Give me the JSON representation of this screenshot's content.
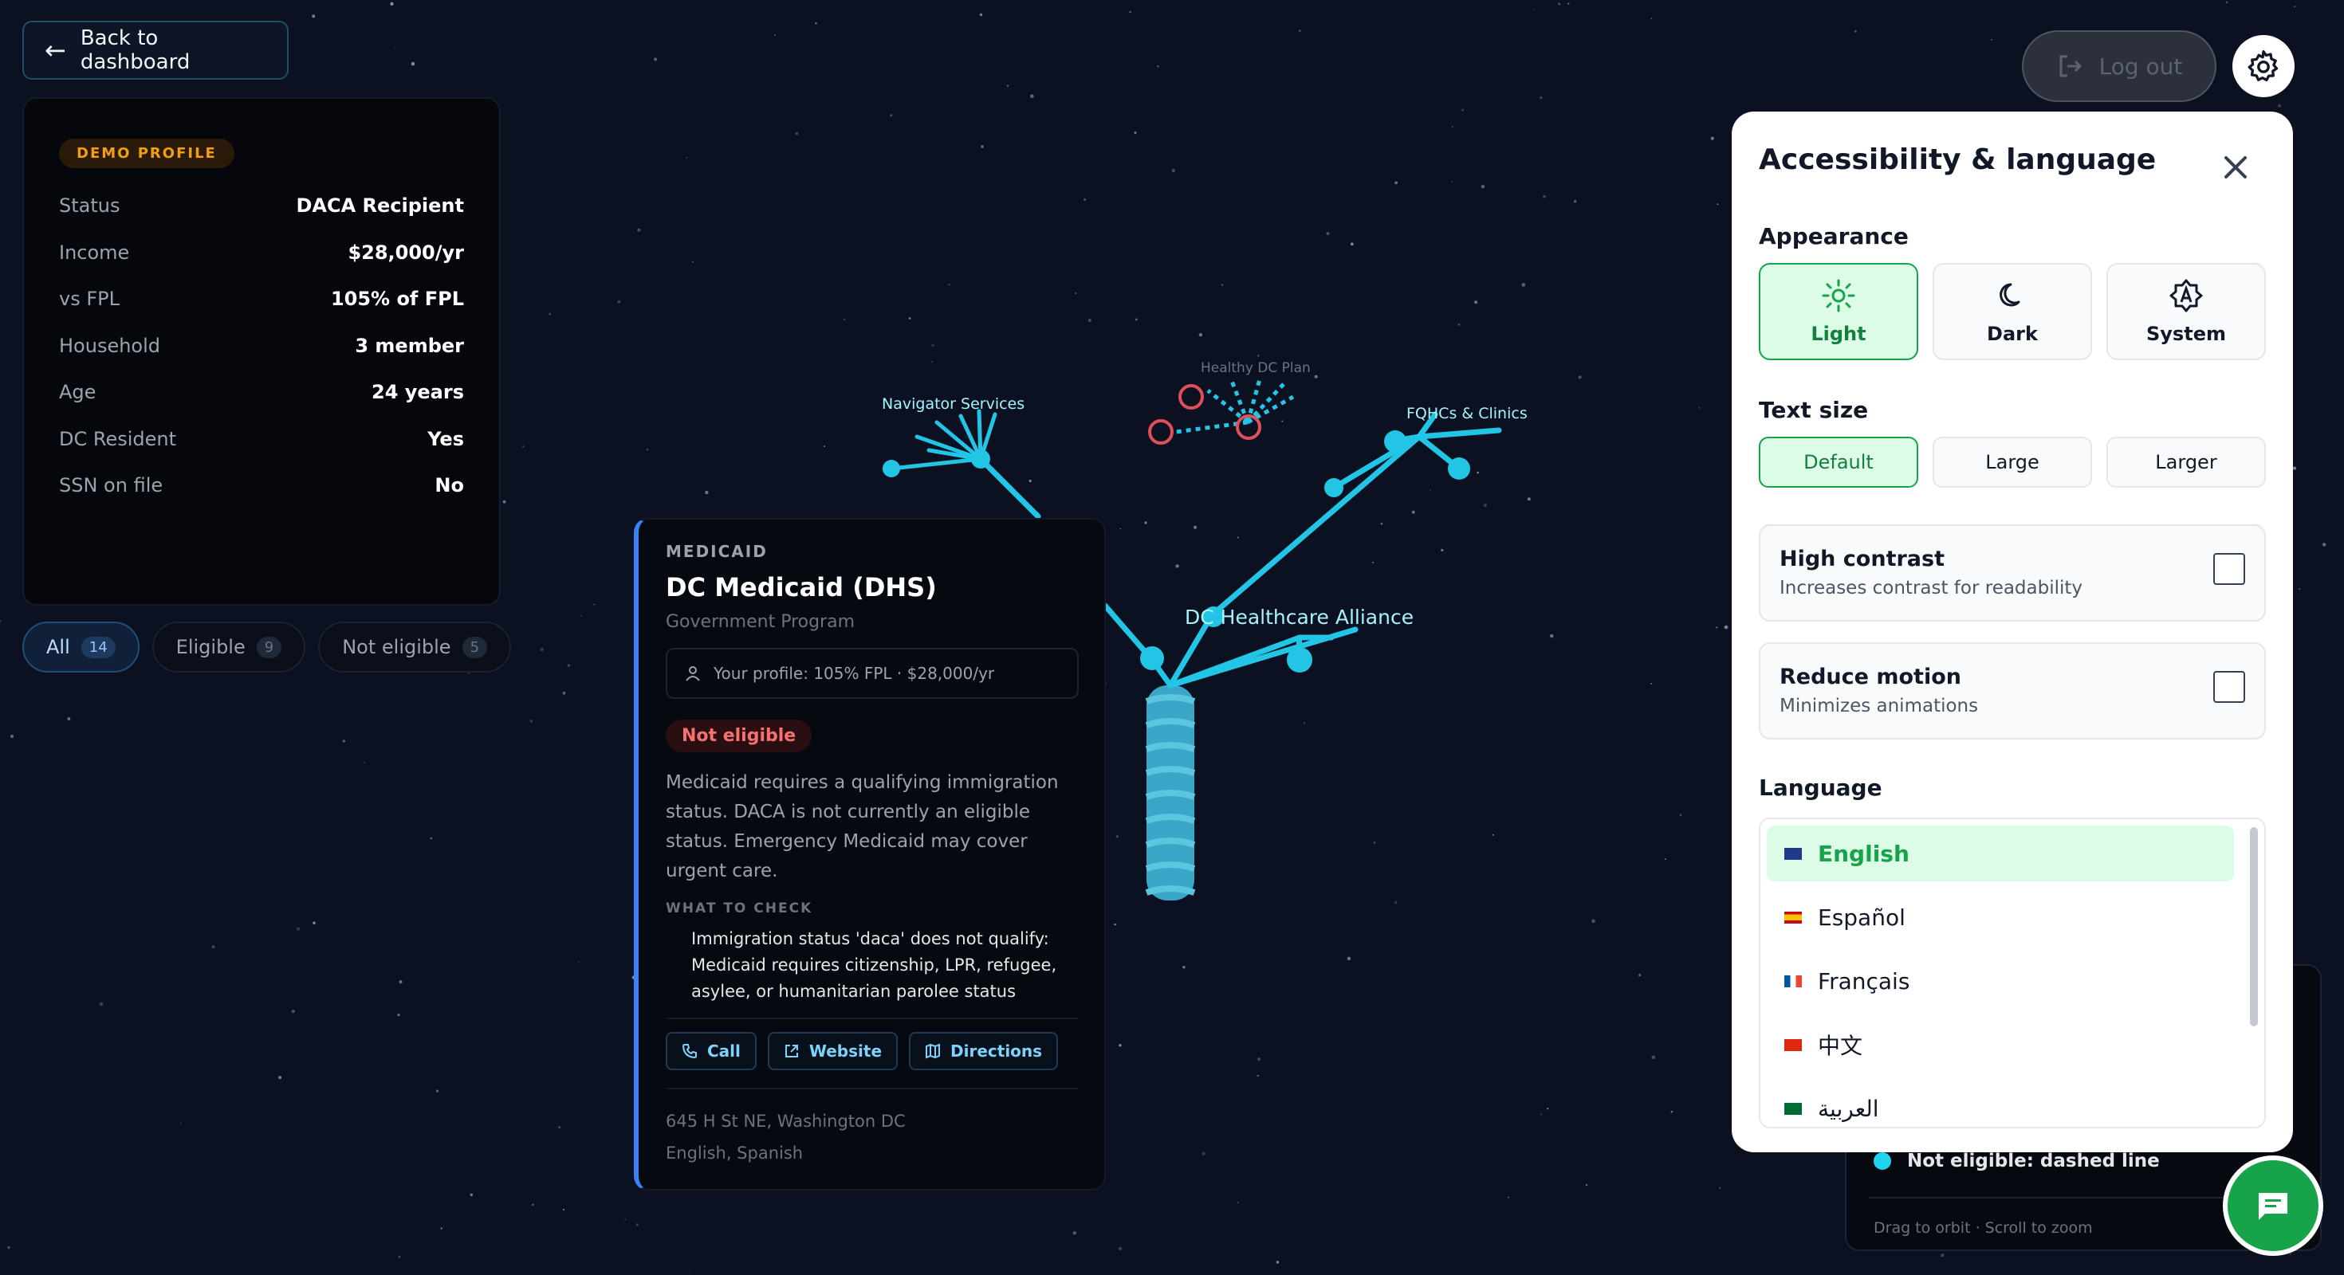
{
  "nav": {
    "back_label": "Back to dashboard"
  },
  "profile": {
    "badge": "DEMO PROFILE",
    "rows": [
      {
        "key": "Status",
        "value": "DACA Recipient"
      },
      {
        "key": "Income",
        "value": "$28,000/yr"
      },
      {
        "key": "vs FPL",
        "value": "105% of FPL"
      },
      {
        "key": "Household",
        "value": "3 member"
      },
      {
        "key": "Age",
        "value": "24 years"
      },
      {
        "key": "DC Resident",
        "value": "Yes"
      },
      {
        "key": "SSN on file",
        "value": "No"
      }
    ]
  },
  "filters": [
    {
      "label": "All",
      "count": "14"
    },
    {
      "label": "Eligible",
      "count": "9"
    },
    {
      "label": "Not eligible",
      "count": "5"
    }
  ],
  "program": {
    "kicker": "MEDICAID",
    "title": "DC Medicaid (DHS)",
    "type": "Government Program",
    "profile_line": "Your profile: 105% FPL · $28,000/yr",
    "status": "Not eligible",
    "description": "Medicaid requires a qualifying immigration status. DACA is not currently an eligible status. Emergency Medicaid may cover urgent care.",
    "check_title": "WHAT TO CHECK",
    "check_text": "Immigration status 'daca' does not qualify: Medicaid requires citizenship, LPR, refugee, asylee, or humanitarian parolee status",
    "actions": {
      "call": "Call",
      "website": "Website",
      "directions": "Directions"
    },
    "address": "645 H St NE, Washington DC",
    "languages": "English, Spanish"
  },
  "tree_labels": {
    "navigator": "Navigator Services",
    "healthy": "Healthy DC Plan",
    "fqhc": "FQHCs & Clinics",
    "alliance": "DC Healthcare Alliance"
  },
  "header": {
    "logout_label": "Log out"
  },
  "legend": {
    "not_eligible": "Not eligible: dashed line",
    "hint": "Drag to orbit · Scroll to zoom"
  },
  "a11y": {
    "title": "Accessibility & language",
    "appearance_label": "Appearance",
    "appearance": {
      "light": "Light",
      "dark": "Dark",
      "system": "System"
    },
    "text_size_label": "Text size",
    "text_size": {
      "default": "Default",
      "large": "Large",
      "larger": "Larger"
    },
    "high_contrast": {
      "title": "High contrast",
      "desc": "Increases contrast for readability"
    },
    "reduce_motion": {
      "title": "Reduce motion",
      "desc": "Minimizes animations"
    },
    "language_label": "Language",
    "languages": [
      "English",
      "Español",
      "Français",
      "中文",
      "العربية"
    ]
  },
  "colors": {
    "accent_green": "#16a34a",
    "tree_cyan": "#22d3ee",
    "not_eligible_red": "#f87171"
  }
}
